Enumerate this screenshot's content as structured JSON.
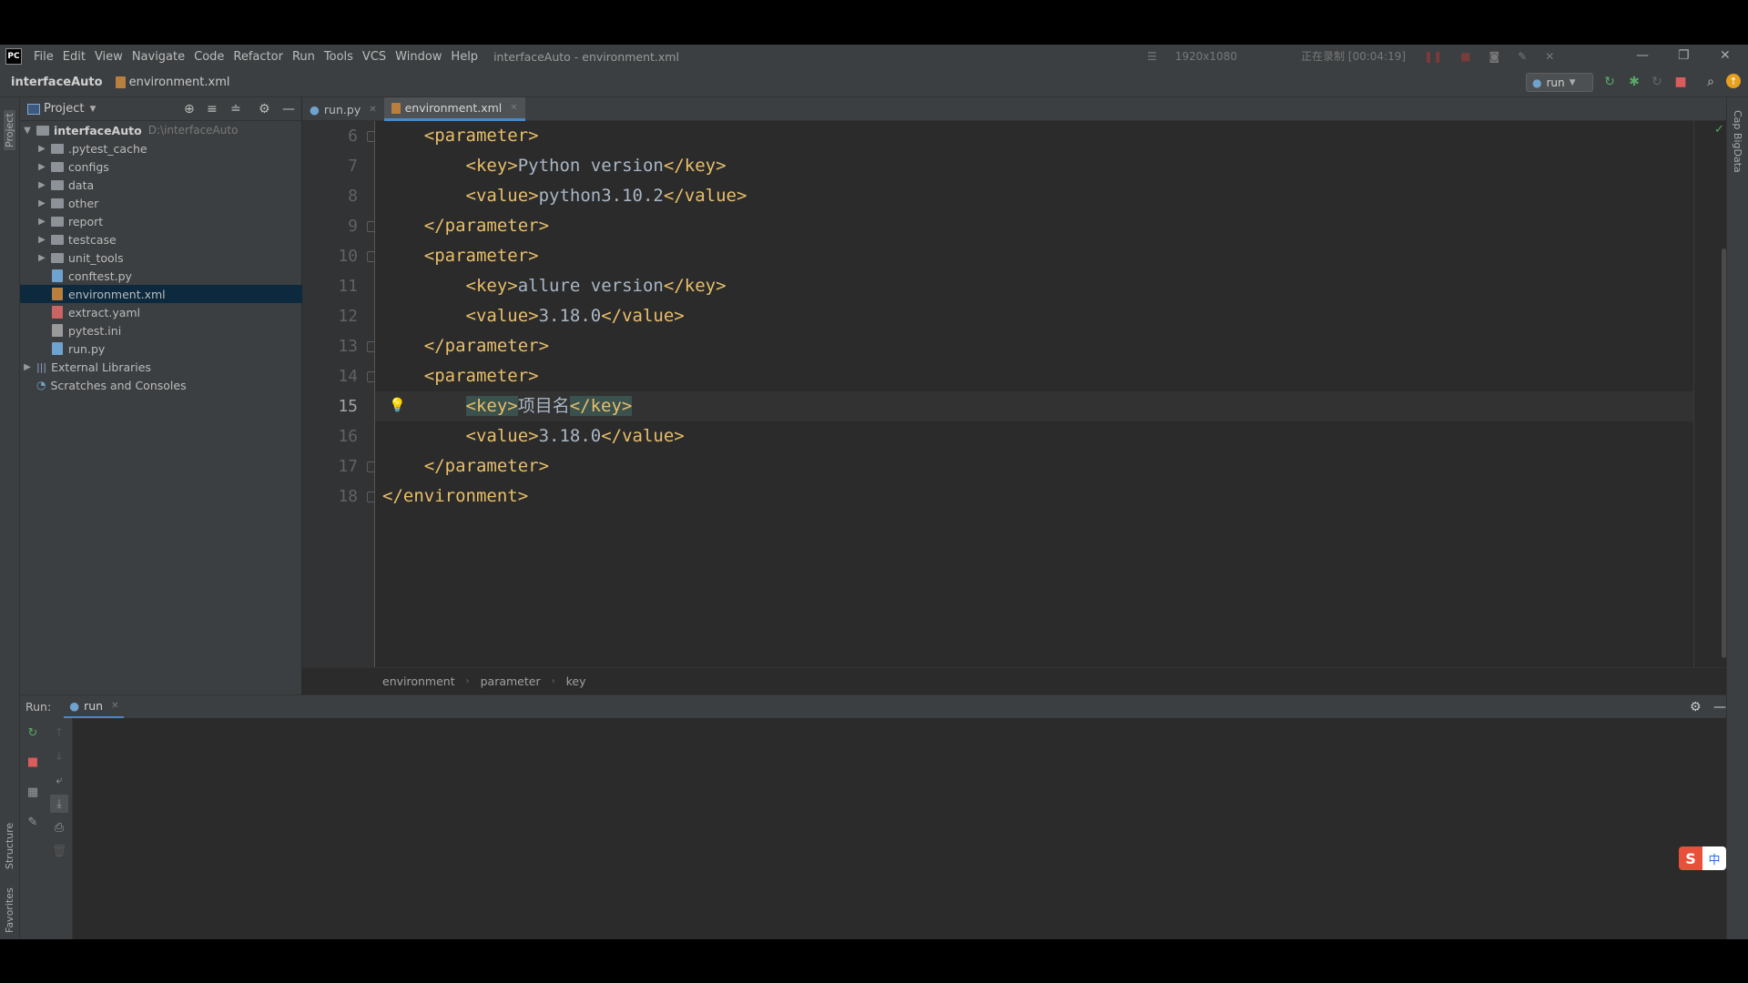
{
  "menubar": {
    "logo": "PC",
    "items": [
      "File",
      "Edit",
      "View",
      "Navigate",
      "Code",
      "Refactor",
      "Run",
      "Tools",
      "VCS",
      "Window",
      "Help"
    ],
    "window_title": "interfaceAuto - environment.xml",
    "recorder": {
      "resolution": "1920x1080",
      "status": "正在录制 [00:04:19]"
    }
  },
  "navbar": {
    "project": "interfaceAuto",
    "file": "environment.xml",
    "run_config": "run"
  },
  "project_panel": {
    "title": "Project",
    "root": {
      "name": "interfaceAuto",
      "path": "D:\\interfaceAuto"
    },
    "items": [
      {
        "name": ".pytest_cache",
        "type": "folder"
      },
      {
        "name": "configs",
        "type": "folder"
      },
      {
        "name": "data",
        "type": "folder"
      },
      {
        "name": "other",
        "type": "folder"
      },
      {
        "name": "report",
        "type": "folder"
      },
      {
        "name": "testcase",
        "type": "folder"
      },
      {
        "name": "unit_tools",
        "type": "folder"
      },
      {
        "name": "conftest.py",
        "type": "py"
      },
      {
        "name": "environment.xml",
        "type": "xml"
      },
      {
        "name": "extract.yaml",
        "type": "yaml"
      },
      {
        "name": "pytest.ini",
        "type": "ini"
      },
      {
        "name": "run.py",
        "type": "py"
      }
    ],
    "external_libraries": "External Libraries",
    "scratches": "Scratches and Consoles"
  },
  "tabs": [
    {
      "label": "run.py"
    },
    {
      "label": "environment.xml"
    }
  ],
  "editor": {
    "lines": [
      {
        "num": "6",
        "indent": "    ",
        "parts": [
          {
            "t": "tag",
            "v": "<parameter>"
          }
        ]
      },
      {
        "num": "7",
        "indent": "        ",
        "parts": [
          {
            "t": "tag",
            "v": "<key>"
          },
          {
            "t": "txt",
            "v": "Python version"
          },
          {
            "t": "tag",
            "v": "</key>"
          }
        ]
      },
      {
        "num": "8",
        "indent": "        ",
        "parts": [
          {
            "t": "tag",
            "v": "<value>"
          },
          {
            "t": "txt",
            "v": "python3.10.2"
          },
          {
            "t": "tag",
            "v": "</value>"
          }
        ]
      },
      {
        "num": "9",
        "indent": "    ",
        "parts": [
          {
            "t": "tag",
            "v": "</parameter>"
          }
        ]
      },
      {
        "num": "10",
        "indent": "    ",
        "parts": [
          {
            "t": "tag",
            "v": "<parameter>"
          }
        ]
      },
      {
        "num": "11",
        "indent": "        ",
        "parts": [
          {
            "t": "tag",
            "v": "<key>"
          },
          {
            "t": "txt",
            "v": "allure version"
          },
          {
            "t": "tag",
            "v": "</key>"
          }
        ]
      },
      {
        "num": "12",
        "indent": "        ",
        "parts": [
          {
            "t": "tag",
            "v": "<value>"
          },
          {
            "t": "txt",
            "v": "3.18.0"
          },
          {
            "t": "tag",
            "v": "</value>"
          }
        ]
      },
      {
        "num": "13",
        "indent": "    ",
        "parts": [
          {
            "t": "tag",
            "v": "</parameter>"
          }
        ]
      },
      {
        "num": "14",
        "indent": "    ",
        "parts": [
          {
            "t": "tag",
            "v": "<parameter>"
          }
        ]
      },
      {
        "num": "15",
        "indent": "        ",
        "parts": [
          {
            "t": "tag",
            "v": "<key>",
            "hl": true
          },
          {
            "t": "txt",
            "v": "项目名"
          },
          {
            "t": "tag",
            "v": "</key>",
            "hl": true
          }
        ]
      },
      {
        "num": "16",
        "indent": "        ",
        "parts": [
          {
            "t": "tag",
            "v": "<value>"
          },
          {
            "t": "txt",
            "v": "3.18.0"
          },
          {
            "t": "tag",
            "v": "</value>"
          }
        ]
      },
      {
        "num": "17",
        "indent": "    ",
        "parts": [
          {
            "t": "tag",
            "v": "</parameter>"
          }
        ]
      },
      {
        "num": "18",
        "indent": "",
        "parts": [
          {
            "t": "tag",
            "v": "</environment>"
          }
        ]
      }
    ],
    "current_line": "15"
  },
  "breadcrumb": [
    "environment",
    "parameter",
    "key"
  ],
  "run_panel": {
    "label": "Run:",
    "tab": "run"
  },
  "side_labels": {
    "project": "Project",
    "structure": "Structure",
    "favorites": "Favorites",
    "right": "Cap BigData"
  },
  "ime": {
    "s": "S",
    "lang": "中"
  }
}
